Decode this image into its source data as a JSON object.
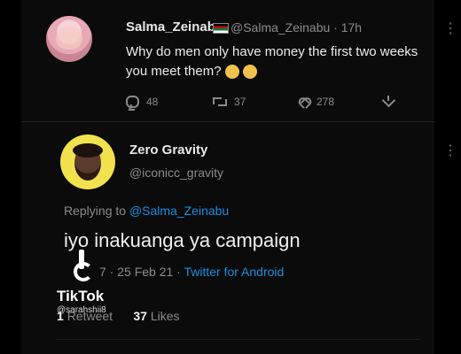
{
  "tweet1": {
    "name": "Salma_Zeinab",
    "meta": "@Salma_Zeinabu · 17h",
    "text": "Why do men only have money the first two weeks you meet them?",
    "actions": {
      "replies": "48",
      "retweets": "37",
      "likes": "278"
    }
  },
  "tweet2": {
    "name": "Zero Gravity",
    "handle": "@iconicc_gravity",
    "replying_prefix": "Replying to",
    "replying_handle": "@Salma_Zeinabu",
    "text": "iyo inakuanga ya campaign",
    "timestamp": "7 · 25 Feb 21 ·",
    "app": "Twitter for Android",
    "stats": {
      "retweets_count": "1",
      "retweets_label": "Retweet",
      "likes_count": "37",
      "likes_label": "Likes"
    }
  },
  "overlay": {
    "brand": "TikTok",
    "username": "@sarahshii8"
  },
  "icons": {
    "reply": "reply-icon",
    "retweet": "retweet-icon",
    "like": "heart-icon",
    "share": "share-icon",
    "more": "more-icon",
    "flag": "kenya-flag-icon",
    "tiktok": "tiktok-icon"
  }
}
